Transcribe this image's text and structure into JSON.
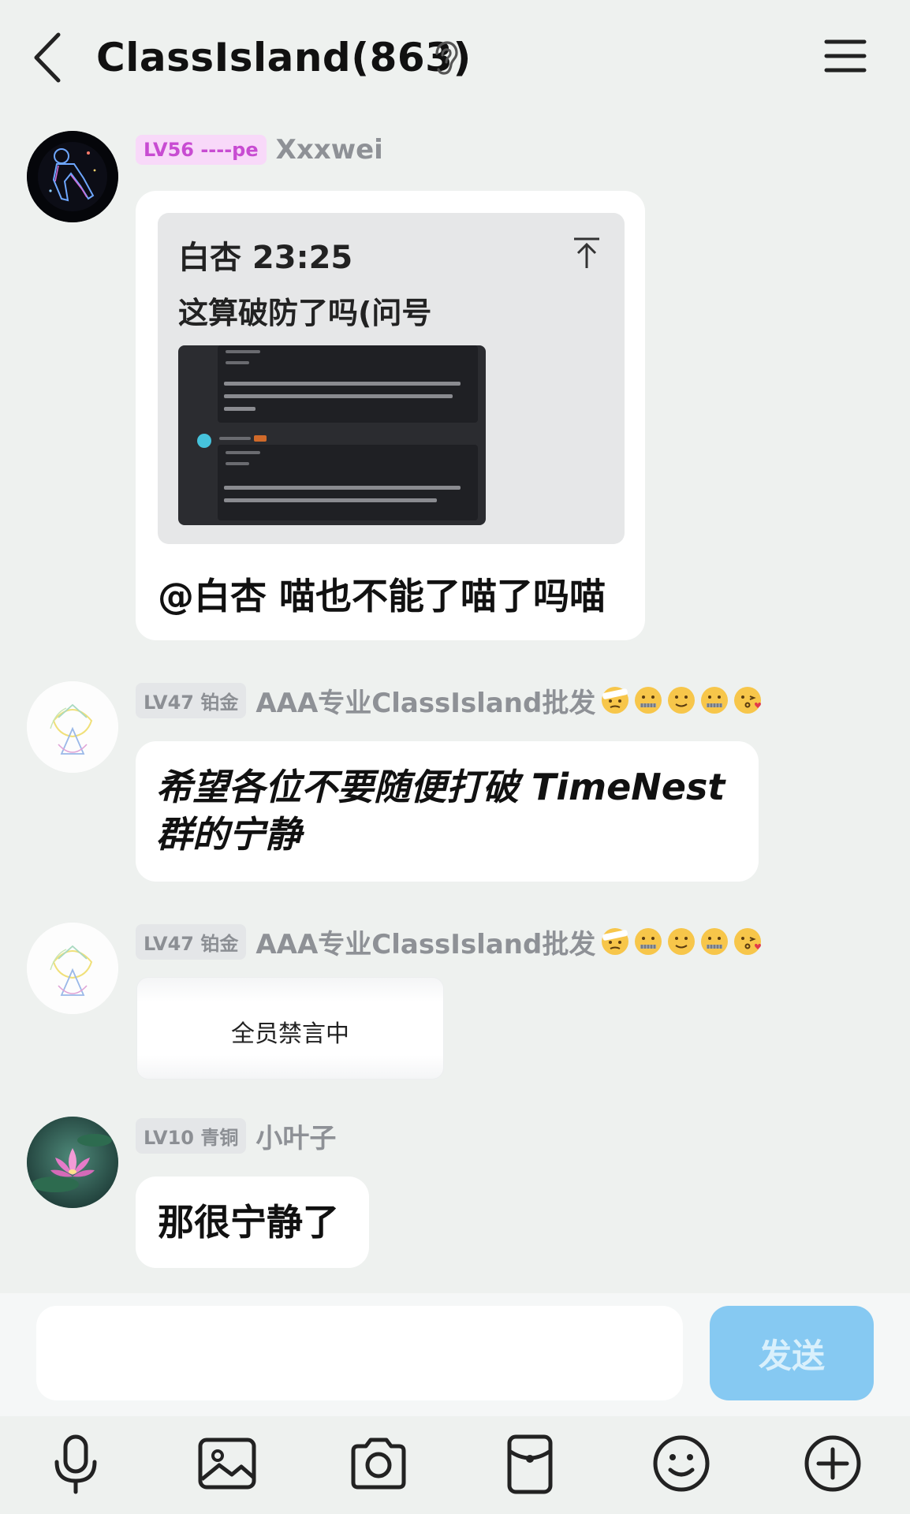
{
  "header": {
    "title": "ClassIsland(863)",
    "icons": [
      "back-icon",
      "ear-icon",
      "menu-icon"
    ]
  },
  "messages": [
    {
      "badge": "LV56 ----pe",
      "badge_color": "#c84cd2",
      "sender": "Xxxwei",
      "quote": {
        "author_time": "白杏 23:25",
        "text": "这算破防了吗(问号"
      },
      "text": "@白杏 喵也不能了喵了吗喵"
    },
    {
      "badge": "LV47 铂金",
      "sender": "AAA专业ClassIsland批发",
      "emojis": [
        "bandage-face-emoji",
        "zipper-mouth-emoji",
        "slight-smile-emoji",
        "zipper-mouth-emoji",
        "kiss-emoji"
      ],
      "text_line1": "希望各位不要随便打破 TimeNest",
      "text_line2": "群的宁静"
    },
    {
      "badge": "LV47 铂金",
      "sender": "AAA专业ClassIsland批发",
      "system": "全员禁言中"
    },
    {
      "badge": "LV10 青铜",
      "sender": "小叶子",
      "text": "那很宁静了"
    }
  ],
  "input": {
    "value": "",
    "send_label": "发送"
  },
  "toolbar": [
    "microphone-icon",
    "image-icon",
    "camera-icon",
    "red-packet-icon",
    "emoji-icon",
    "plus-icon"
  ],
  "colors": {
    "background": "#eef1ef",
    "send_button": "#86c9f2",
    "pink_badge": "#f8d9f9"
  }
}
